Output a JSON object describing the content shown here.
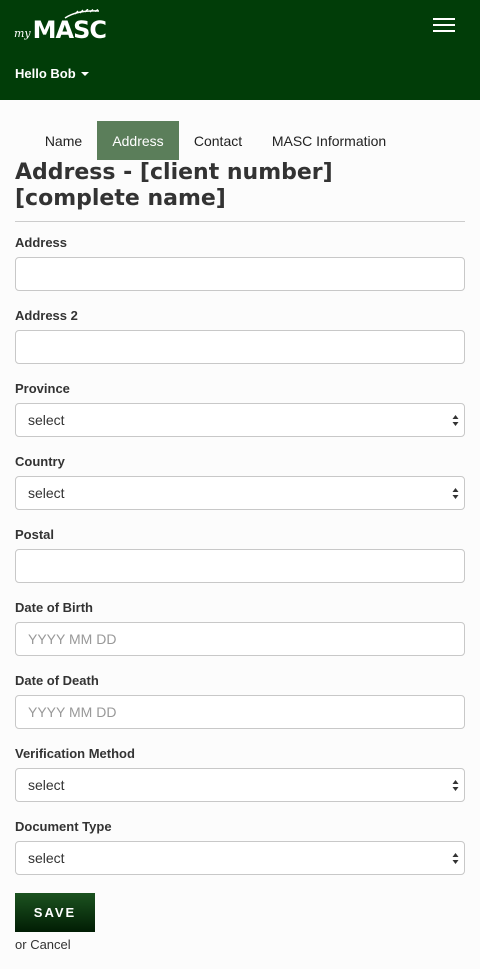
{
  "header": {
    "logo_prefix": "my",
    "logo_name": "MASC",
    "greeting": "Hello Bob"
  },
  "tabs": [
    {
      "label": "Name",
      "active": false
    },
    {
      "label": "Address",
      "active": true
    },
    {
      "label": "Contact",
      "active": false
    },
    {
      "label": "MASC Information",
      "active": false
    }
  ],
  "page_title": "Address - [client number] [complete name]",
  "form": {
    "address_label": "Address",
    "address_value": "",
    "address2_label": "Address 2",
    "address2_value": "",
    "province_label": "Province",
    "province_value": "select",
    "country_label": "Country",
    "country_value": "select",
    "postal_label": "Postal",
    "postal_value": "",
    "dob_label": "Date of Birth",
    "dob_placeholder": "YYYY MM DD",
    "dod_label": "Date of Death",
    "dod_placeholder": "YYYY MM DD",
    "verification_label": "Verification Method",
    "verification_value": "select",
    "doctype_label": "Document Type",
    "doctype_value": "select"
  },
  "actions": {
    "save_label": "SAVE",
    "or_text": "or",
    "cancel_label": "Cancel"
  },
  "colors": {
    "header_bg": "#013d08",
    "active_tab_bg": "#5b7e5a",
    "save_bg": "#011d04"
  }
}
